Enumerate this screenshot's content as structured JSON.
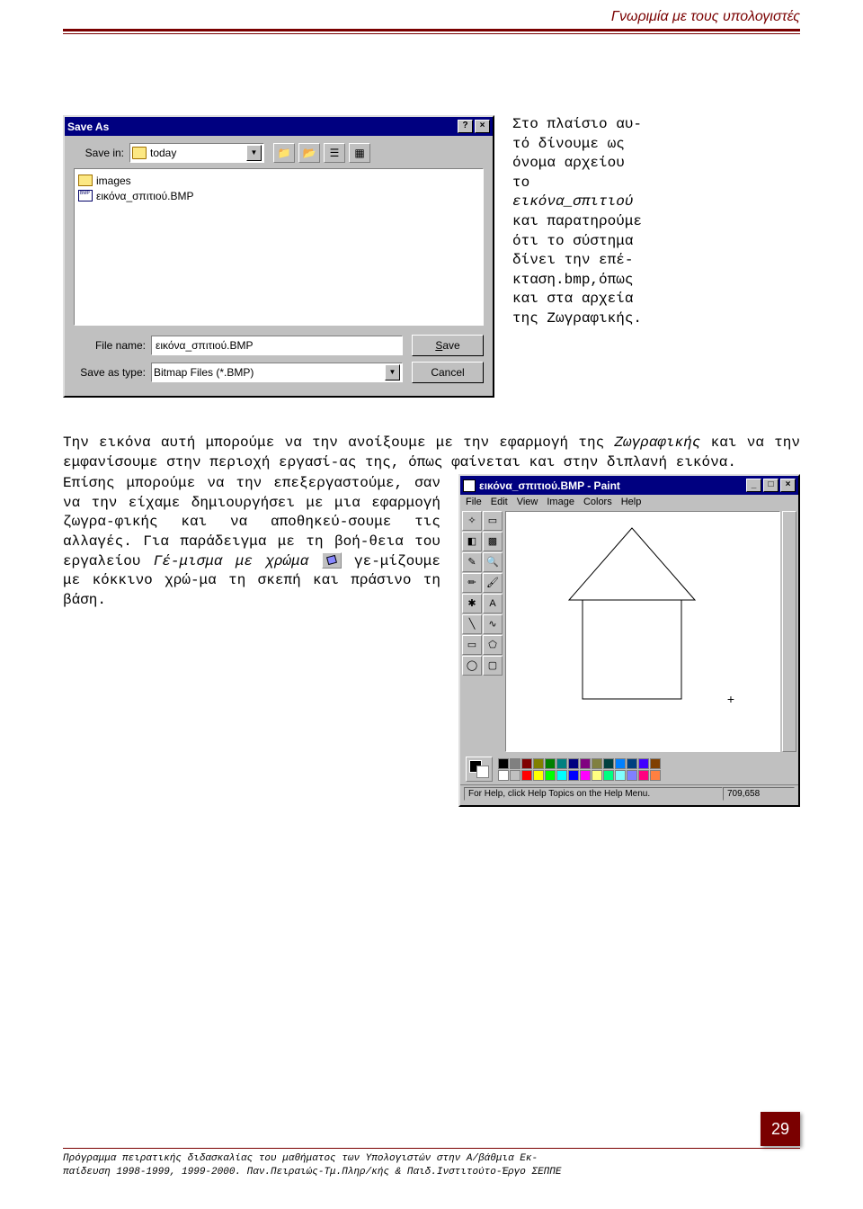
{
  "header": {
    "title": "Γνωριμία με τους υπολογιστές"
  },
  "saveas": {
    "title": "Save As",
    "save_in_label": "Save in:",
    "save_in_value": "today",
    "items": {
      "folder": "images",
      "file": "εικόνα_σπιτιού.BMP"
    },
    "filename_label": "File name:",
    "filename_value": "εικόνα_σπιτιού.BMP",
    "saveastype_label": "Save as type:",
    "saveastype_value": "Bitmap Files (*.BMP)",
    "save_btn": "Save",
    "cancel_btn": "Cancel"
  },
  "right_text": {
    "t1": "Στο πλαίσιο αυ-",
    "t2": "τό δίνουμε ως",
    "t3": "όνομα αρχείου",
    "t4": "το",
    "t5": "εικόνα_σπιτιού",
    "t6": "και παρατηρούμε",
    "t7": "ότι το σύστημα",
    "t8": "δίνει την επέ-",
    "t9": "κταση.bmp,όπως",
    "t10": "και στα αρχεία",
    "t11": "της Ζωγραφικής."
  },
  "para1_a": "Την εικόνα αυτή μπορούμε να την ανοίξουμε με την εφαρμογή της ",
  "para1_em": "Ζωγραφικής",
  "para1_b": " και να την εμφανίσουμε στην περιοχή εργασί-ας της, όπως φαίνεται και στην διπλανή εικόνα.",
  "left_text": {
    "a": "Επίσης μπορούμε να την επεξεργαστούμε, σαν να την είχαμε δημιουργήσει με μια εφαρμογή ζωγρα-φικής και να αποθηκεύ-σουμε τις αλλαγές. Για παράδειγμα με τη βοή-θεια του εργαλείου ",
    "em1": "Γέ-μισμα με χρώμα",
    "b": " γε-μίζουμε με κόκκινο χρώ-μα τη σκεπή και πράσινο τη βάση."
  },
  "paint": {
    "title": "εικόνα_σπιτιού.BMP - Paint",
    "menu": [
      "File",
      "Edit",
      "View",
      "Image",
      "Colors",
      "Help"
    ],
    "status": "For Help, click Help Topics on the Help Menu.",
    "coords": "709,658",
    "palette": [
      "#000000",
      "#808080",
      "#800000",
      "#808000",
      "#008000",
      "#008080",
      "#000080",
      "#800080",
      "#808040",
      "#004040",
      "#0080ff",
      "#004080",
      "#4000ff",
      "#804000",
      "#ffffff",
      "#c0c0c0",
      "#ff0000",
      "#ffff00",
      "#00ff00",
      "#00ffff",
      "#0000ff",
      "#ff00ff",
      "#ffff80",
      "#00ff80",
      "#80ffff",
      "#8080ff",
      "#ff0080",
      "#ff8040"
    ]
  },
  "page_number": "29",
  "footer": {
    "line1": "Πρόγραμμα πειρατικής διδασκαλίας του μαθήματος των Υπολογιστών στην  Α/βάθμια Εκ-",
    "line2": "παίδευση 1998-1999, 1999-2000. Παν.Πειραιώς-Τμ.Πληρ/κής & Παιδ.Ινστιτούτο-Έργο ΣΕΠΠΕ"
  }
}
